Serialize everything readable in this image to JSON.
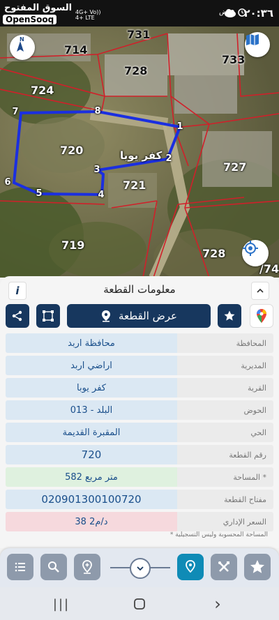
{
  "status_bar": {
    "time": "٢٠:٣٦",
    "carrier_line1": "4G+ Vo))",
    "carrier_line2": "4+ LTE",
    "brand_ar": "السوق المفتوح",
    "brand_en": "OpenSooq",
    "pulse_label": "نبض"
  },
  "map": {
    "plots": [
      {
        "id": "731",
        "label": "731",
        "dark": true
      },
      {
        "id": "714",
        "label": "714",
        "dark": true
      },
      {
        "id": "728a",
        "label": "728",
        "dark": true
      },
      {
        "id": "733",
        "label": "733",
        "dark": true
      },
      {
        "id": "724",
        "label": "724",
        "dark": false
      },
      {
        "id": "720",
        "label": "720",
        "dark": false
      },
      {
        "id": "721",
        "label": "721",
        "dark": false
      },
      {
        "id": "727",
        "label": "727",
        "dark": false
      },
      {
        "id": "719",
        "label": "719",
        "dark": false
      },
      {
        "id": "728b",
        "label": "728",
        "dark": false
      },
      {
        "id": "74",
        "label": "/74",
        "dark": false
      }
    ],
    "village_label": "كفر يوبا",
    "vertices": [
      "1",
      "2",
      "3",
      "4",
      "5",
      "6",
      "7",
      "8"
    ],
    "compass_letter": "N",
    "colors": {
      "boundary": "#1b2fe0",
      "parcel_lines": "#d0202a"
    }
  },
  "panel": {
    "title": "معلومات القطعة",
    "show_plot_label": "عرض القطعة",
    "rows": [
      {
        "label": "المحافظة",
        "value": "محافظة اربد"
      },
      {
        "label": "المديرية",
        "value": "اراضي اربد"
      },
      {
        "label": "القرية",
        "value": "كفر يوبا"
      },
      {
        "label": "الحوض",
        "value": "البلد - 013"
      },
      {
        "label": "الحي",
        "value": "المقبرة القديمة"
      },
      {
        "label": "رقم القطعة",
        "value": "720"
      },
      {
        "label": "المساحة *",
        "value": "582  متر مربع"
      },
      {
        "label": "مفتاح القطعة",
        "value": "020901300100720"
      },
      {
        "label": "السعر الإداري",
        "value": "38 د/م2"
      }
    ],
    "note": "* المساحة المحسوبة وليس التسجيلية",
    "colors": {
      "value_bg": "#dbe8f3",
      "area_bg": "#dff1df",
      "price_bg": "#f6d9dd",
      "navy": "#17375e"
    }
  },
  "toolbar": {
    "icons": [
      "list-icon",
      "search-icon",
      "pin-plus-icon",
      "chevron-down-icon",
      "location-pin-icon",
      "tools-icon",
      "star-icon"
    ],
    "active_color": "#0f8bb6"
  },
  "nav": {
    "recents": "|||",
    "back": "›"
  }
}
